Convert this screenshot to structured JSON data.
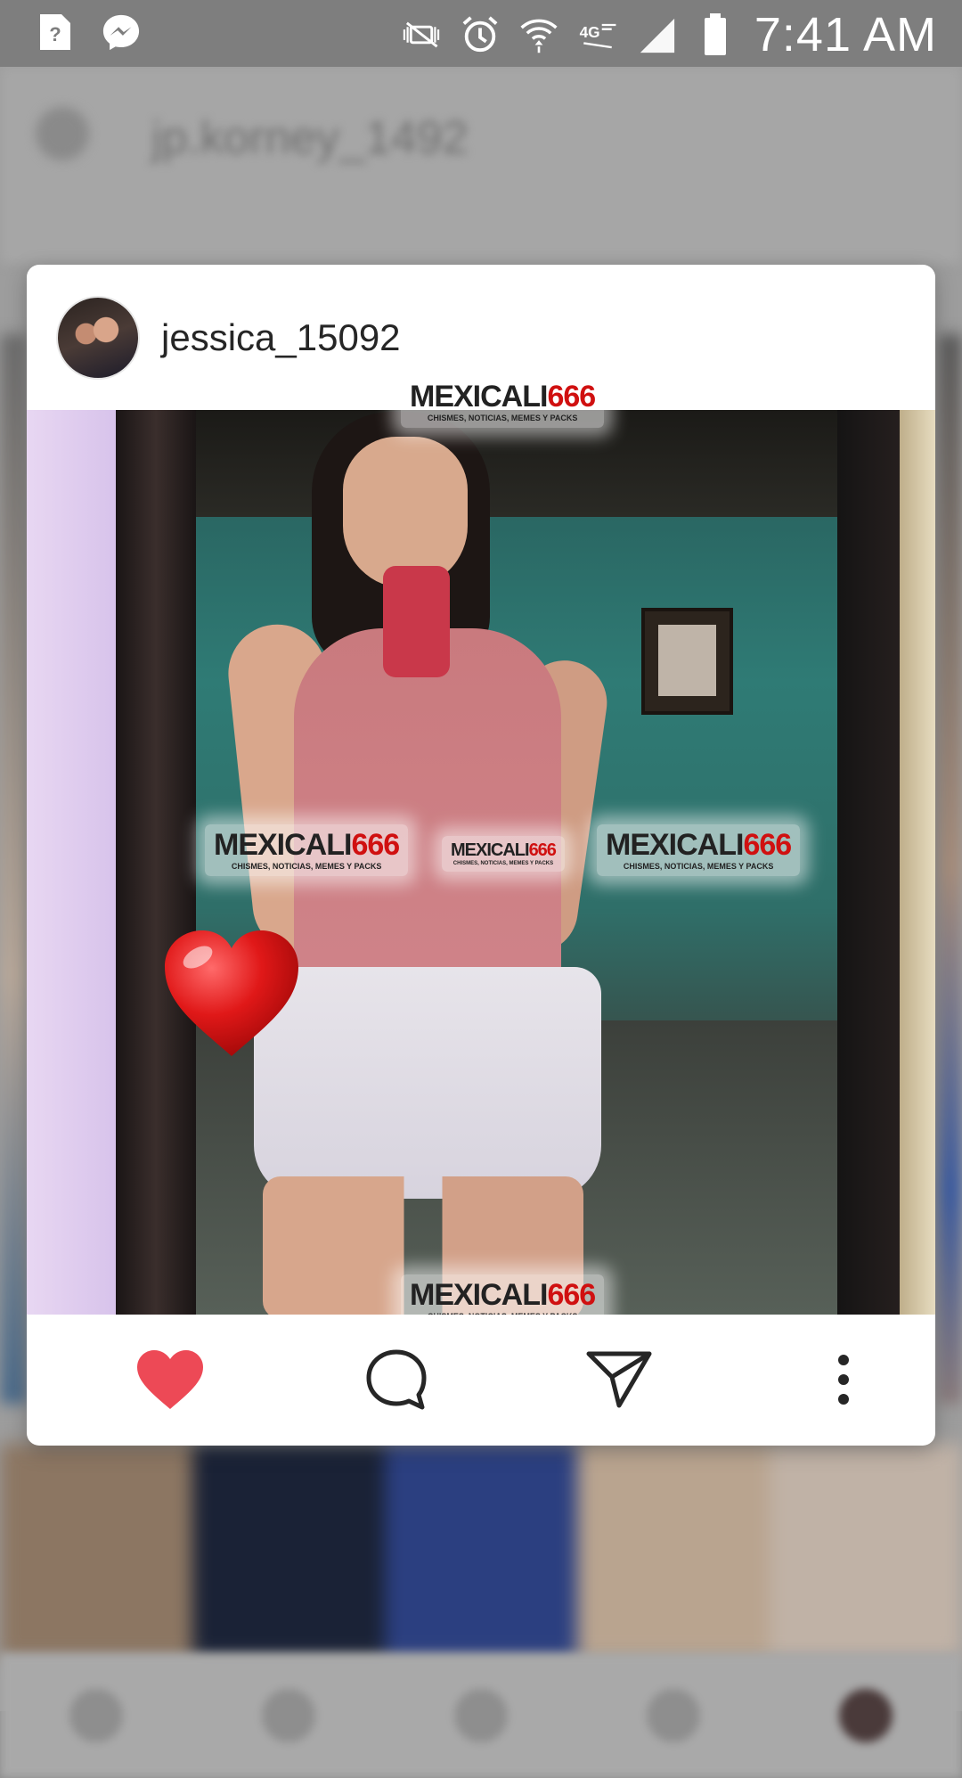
{
  "status_bar": {
    "time": "7:41 AM",
    "icons": [
      "help-notification-icon",
      "messenger-icon",
      "mute-icon",
      "alarm-icon",
      "wifi-icon",
      "lte-icon",
      "signal-icon",
      "battery-icon"
    ]
  },
  "background": {
    "title": "jp.korney_1492"
  },
  "preview": {
    "username": "jessica_15092",
    "watermark": {
      "brand": "MEXICALI",
      "number": "666",
      "tagline": "CHISMES, NOTICIAS, MEMES Y PACKS"
    },
    "actions": [
      "like-icon",
      "comment-icon",
      "share-icon",
      "more-icon"
    ],
    "liked": true,
    "colors": {
      "like": "#ed4956",
      "icon": "#262626"
    }
  }
}
